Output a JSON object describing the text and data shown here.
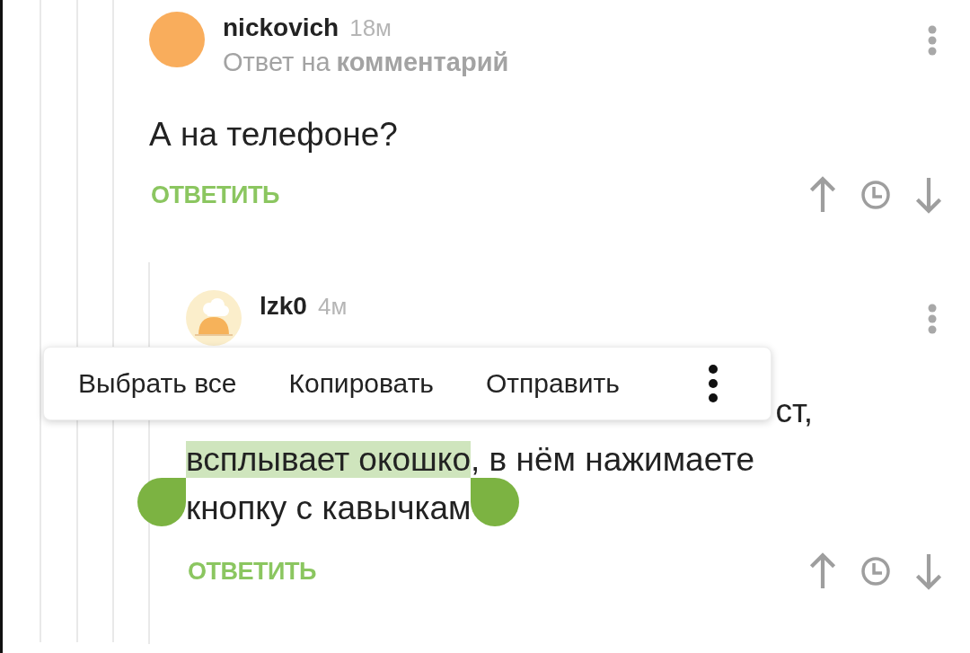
{
  "comments": [
    {
      "avatar": {
        "kind": "circle",
        "color": "#f9ad5c"
      },
      "author": "nickovich",
      "time": "18м",
      "reply_prefix": "Ответ на",
      "reply_target": "комментарий",
      "body": [
        [
          {
            "text": "А на телефоне?",
            "selected": false
          }
        ]
      ],
      "reply_button": "ОТВЕТИТЬ"
    },
    {
      "avatar": {
        "kind": "chef"
      },
      "author": "lzk0",
      "time": "4м",
      "body": [
        [
          {
            "text": "ст,",
            "selected": false
          }
        ],
        [
          {
            "text": "всплывает окошко",
            "selected": true
          },
          {
            "text": ", в нём нажимаете",
            "selected": false
          }
        ],
        [
          {
            "text": "кнопку с кавычкам",
            "selected": false
          }
        ]
      ],
      "reply_button": "ОТВЕТИТЬ"
    }
  ],
  "text_menu": {
    "items": [
      "Выбрать все",
      "Копировать",
      "Отправить"
    ]
  }
}
